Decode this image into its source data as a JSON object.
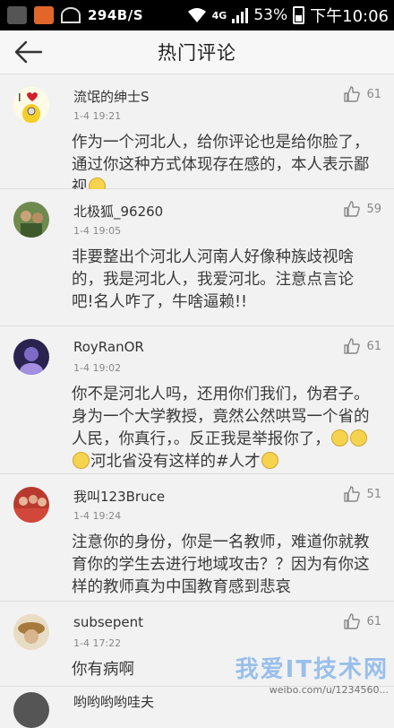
{
  "status_bar": {
    "network_speed": "294B/S",
    "network_type": "4G",
    "battery": "53%",
    "time": "下午10:06"
  },
  "header": {
    "title": "热门评论"
  },
  "comments": [
    {
      "username": "流氓的绅士S",
      "time": "1-4 19:21",
      "likes": "61",
      "text": "作为一个河北人，给你评论也是给你脸了，通过你这种方式体现存在感的，本人表示鄙视",
      "emoji_count": 1
    },
    {
      "username": "北极狐_96260",
      "time": "1-4 19:05",
      "likes": "59",
      "text": "非要整出个河北人河南人好像种族歧视啥的，我是河北人，我爱河北。注意点言论吧!名人咋了，牛啥逼赖!!",
      "emoji_count": 0
    },
    {
      "username": "RoyRanOR",
      "time": "1-4 19:02",
      "likes": "61",
      "text_a": "你不是河北人吗，还用你们我们，伪君子。身为一个大学教授，竟然公然哄骂一个省的人民，你真行，。反正我是举报你了，",
      "text_b": "河北省没有这样的#人才",
      "emoji_count": 4
    },
    {
      "username": "我叫123Bruce",
      "time": "1-4 19:24",
      "likes": "51",
      "text": "注意你的身份，你是一名教师，难道你就教育你的学生去进行地域攻击？？因为有你这样的教师真为中国教育感到悲哀",
      "emoji_count": 0
    },
    {
      "username": "subsepent",
      "time": "1-4 17:22",
      "likes": "61",
      "text": "你有病啊",
      "emoji_count": 0
    },
    {
      "username": "哟哟哟哟哇夫",
      "time": "",
      "likes": "",
      "text": "",
      "emoji_count": 0
    }
  ],
  "watermark": {
    "logo": "我爱IT技术网",
    "text": "weibo.com/u/1234560..."
  }
}
